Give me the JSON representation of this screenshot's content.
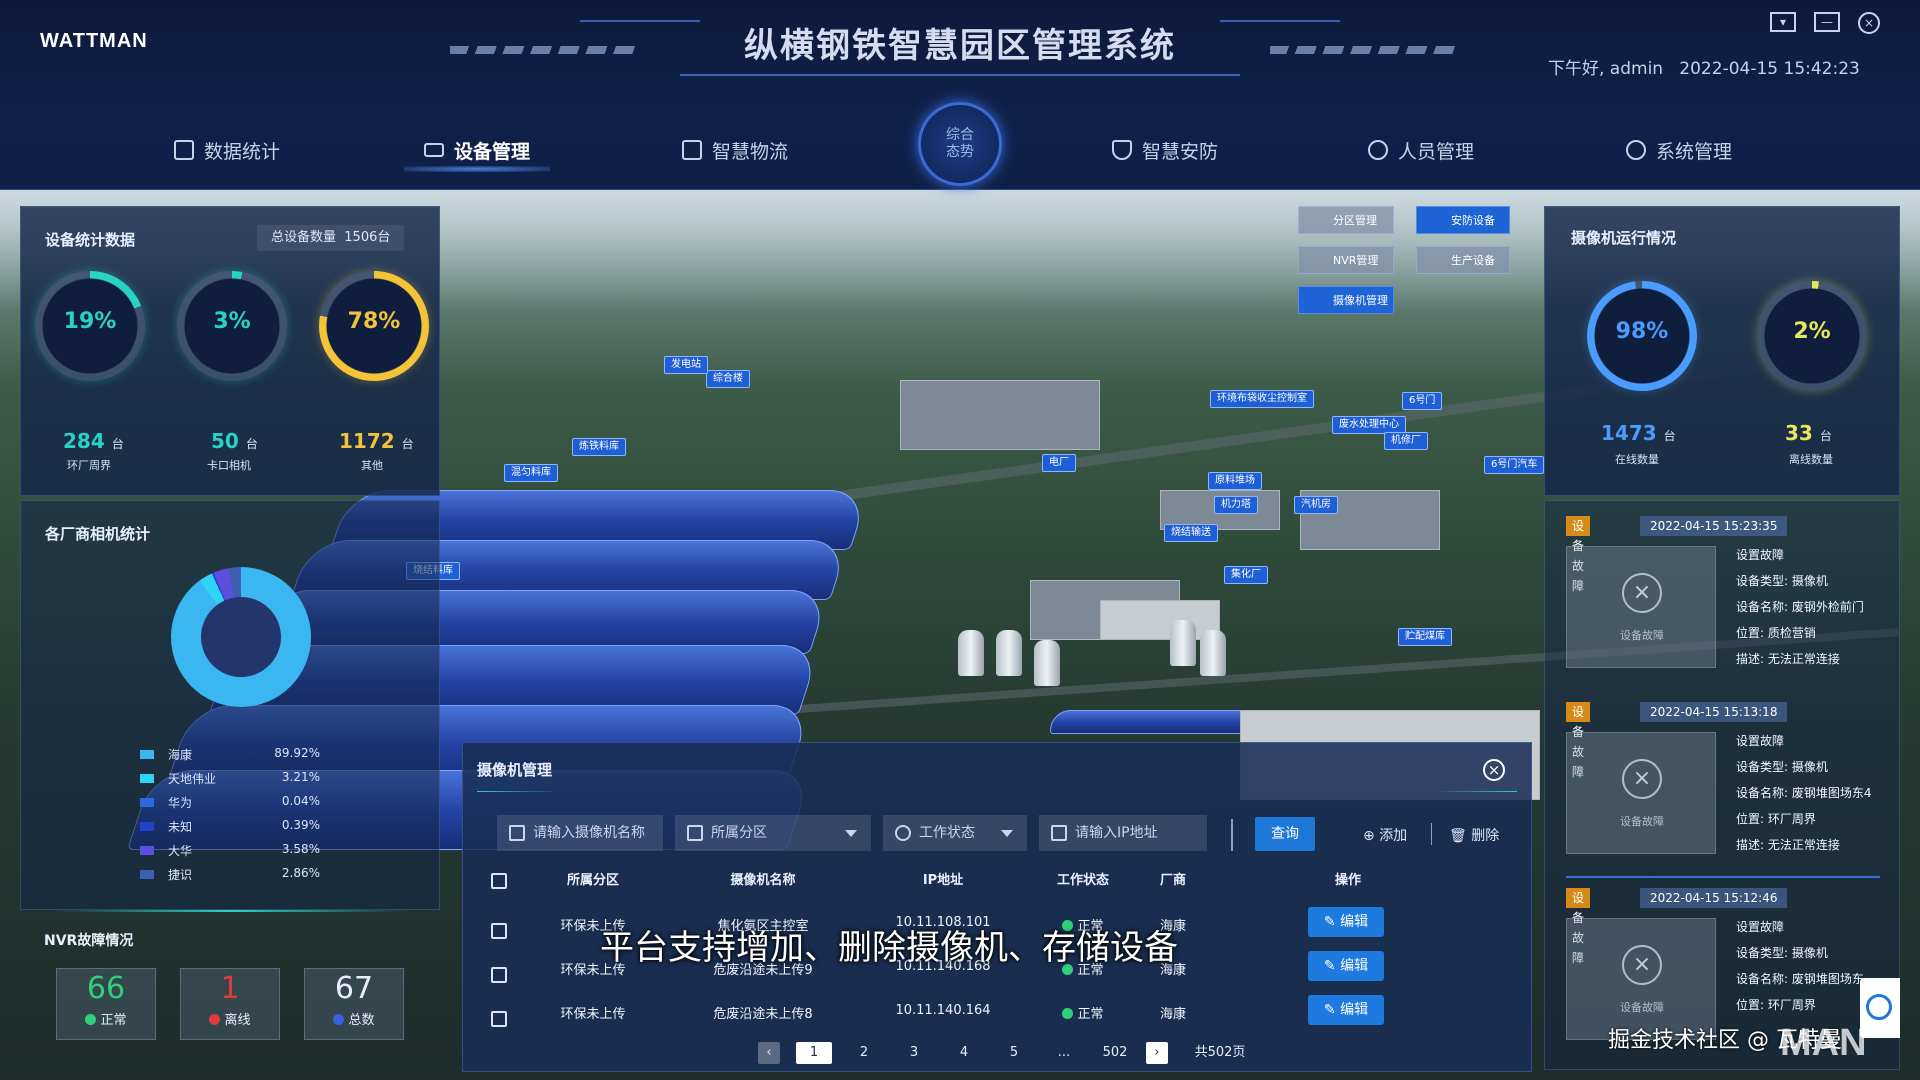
{
  "app": {
    "logo": "WATTMAN",
    "title": "纵横钢铁智慧园区管理系统",
    "greeting": "下午好, admin",
    "datetime": "2022-04-15 15:42:23"
  },
  "nav": {
    "items": [
      {
        "label": "数据统计"
      },
      {
        "label": "设备管理",
        "active": true
      },
      {
        "label": "智慧物流"
      },
      {
        "label": "智慧安防"
      },
      {
        "label": "人员管理"
      },
      {
        "label": "系统管理"
      }
    ],
    "center_line1": "综合",
    "center_line2": "态势"
  },
  "left": {
    "device_stats": {
      "title": "设备统计数据",
      "total_label": "总设备数量",
      "total_value": "1506台",
      "gauges": [
        {
          "percent": "19%",
          "count": "284",
          "unit": "台",
          "label": "环厂周界",
          "color": "#29d3c4",
          "fill": 0.19
        },
        {
          "percent": "3%",
          "count": "50",
          "unit": "台",
          "label": "卡口相机",
          "color": "#29d3c4",
          "fill": 0.03
        },
        {
          "percent": "78%",
          "count": "1172",
          "unit": "台",
          "label": "其他",
          "color": "#f3c33a",
          "fill": 0.78
        }
      ]
    },
    "vendor_stats": {
      "title": "各厂商相机统计",
      "legend": [
        {
          "name": "海康",
          "percent": "89.92%",
          "color": "#3ab6f0"
        },
        {
          "name": "天地伟业",
          "percent": "3.21%",
          "color": "#2fd4f5"
        },
        {
          "name": "华为",
          "percent": "0.04%",
          "color": "#2b6ae0"
        },
        {
          "name": "未知",
          "percent": "0.39%",
          "color": "#1f44c8"
        },
        {
          "name": "大华",
          "percent": "3.58%",
          "color": "#5b4fe0"
        },
        {
          "name": "捷识",
          "percent": "2.86%",
          "color": "#3c5fb0"
        }
      ]
    },
    "nvr": {
      "title": "NVR故障情况",
      "normal": {
        "value": "66",
        "label": "正常"
      },
      "offline": {
        "value": "1",
        "label": "离线"
      },
      "total": {
        "value": "67",
        "label": "总数"
      }
    }
  },
  "right": {
    "camera_status": {
      "title": "摄像机运行情况",
      "online": {
        "percent": "98%",
        "count": "1473",
        "unit": "台",
        "label": "在线数量",
        "fill": 0.98
      },
      "offline": {
        "percent": "2%",
        "count": "33",
        "unit": "台",
        "label": "离线数量",
        "fill": 0.02
      }
    },
    "faults": [
      {
        "tag": "设备故障",
        "time": "2022-04-15 15:23:35",
        "image_caption": "设备故障",
        "lines": [
          "设置故障",
          "设备类型: 摄像机",
          "设备名称: 废钢外检前门",
          "位置: 质检营销",
          "描述: 无法正常连接"
        ]
      },
      {
        "tag": "设备故障",
        "time": "2022-04-15 15:13:18",
        "image_caption": "设备故障",
        "lines": [
          "设置故障",
          "设备类型: 摄像机",
          "设备名称: 废钢堆图场东4",
          "位置: 环厂周界",
          "描述: 无法正常连接"
        ]
      },
      {
        "tag": "设备故障",
        "time": "2022-04-15 15:12:46",
        "image_caption": "设备故障",
        "lines": [
          "设置故障",
          "设备类型: 摄像机",
          "设备名称: 废钢堆图场东",
          "位置: 环厂周界"
        ]
      }
    ]
  },
  "map": {
    "tabs": {
      "zone": "分区管理",
      "security": "安防设备",
      "nvr": "NVR管理",
      "production": "生产设备",
      "camera": "摄像机管理"
    },
    "tags": [
      "炼铁料库",
      "混匀料库",
      "烧结料库",
      "电厂",
      "原料堆场",
      "机力塔",
      "汽机房",
      "烧结输送",
      "集化厂",
      "贮配煤库",
      "综合楼",
      "环境布袋收尘控制室",
      "废水处理中心",
      "机修厂",
      "6号门",
      "6号门汽车",
      "发电站"
    ]
  },
  "camera_mgmt": {
    "title": "摄像机管理",
    "search": {
      "name_placeholder": "请输入摄像机名称",
      "zone_label": "所属分区",
      "status_label": "工作状态",
      "ip_placeholder": "请输入IP地址",
      "query_label": "查询",
      "add_label": "添加",
      "delete_label": "删除"
    },
    "columns": [
      "所属分区",
      "摄像机名称",
      "IP地址",
      "工作状态",
      "厂商",
      "操作"
    ],
    "rows": [
      {
        "zone": "环保未上传",
        "name": "焦化氨区主控室",
        "ip": "10.11.108.101",
        "status": "正常",
        "vendor": "海康",
        "action": "编辑"
      },
      {
        "zone": "环保未上传",
        "name": "危废沿途未上传9",
        "ip": "10.11.140.168",
        "status": "正常",
        "vendor": "海康",
        "action": "编辑"
      },
      {
        "zone": "环保未上传",
        "name": "危废沿途未上传8",
        "ip": "10.11.140.164",
        "status": "正常",
        "vendor": "海康",
        "action": "编辑"
      }
    ],
    "pagination": {
      "pages": [
        "1",
        "2",
        "3",
        "4",
        "5",
        "...",
        "502"
      ],
      "total": "共502页"
    }
  },
  "overlay_caption": "平台支持增加、删除摄像机、存储设备",
  "watermark": "掘金技术社区 @ 瓦特曼",
  "watermark_logo": "MAN"
}
